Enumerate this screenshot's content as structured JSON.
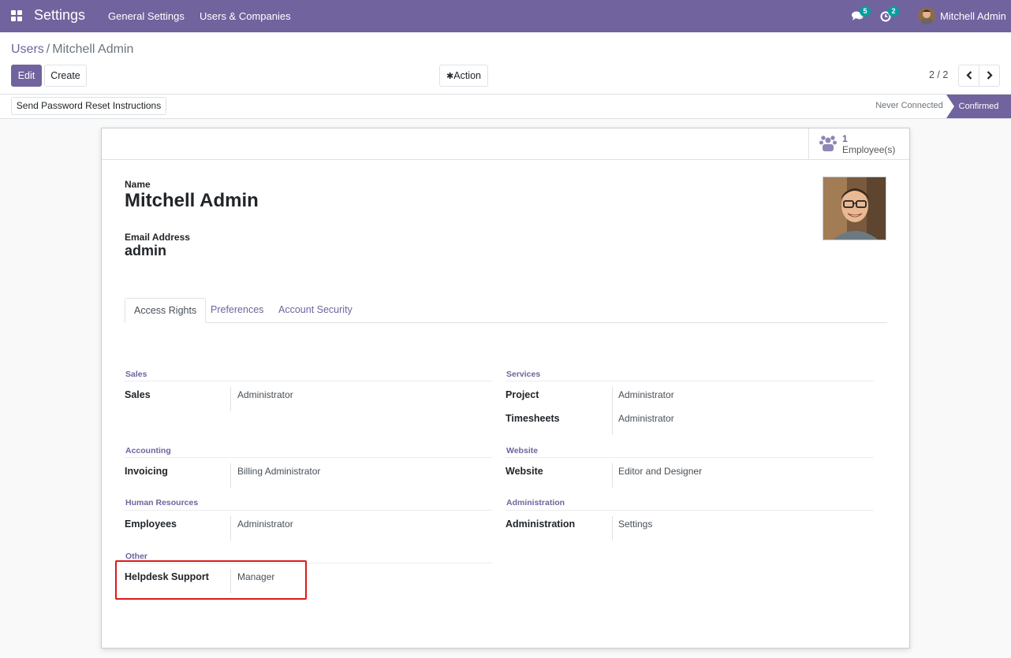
{
  "navbar": {
    "app_title": "Settings",
    "menu": [
      "General Settings",
      "Users & Companies"
    ],
    "messages_count": "5",
    "activities_count": "2",
    "user_name": "Mitchell Admin"
  },
  "breadcrumb": {
    "parent": "Users",
    "separator": "/",
    "current": "Mitchell Admin"
  },
  "toolbar": {
    "edit_label": "Edit",
    "create_label": "Create",
    "action_label": "Action",
    "pager": "2 / 2"
  },
  "statusbar": {
    "reset_button": "Send Password Reset Instructions",
    "stages": [
      "Never Connected",
      "Confirmed"
    ],
    "active_stage": "Confirmed"
  },
  "smart_button": {
    "value": "1",
    "label": "Employee(s)"
  },
  "form": {
    "name_label": "Name",
    "name_value": "Mitchell Admin",
    "email_label": "Email Address",
    "email_value": "admin"
  },
  "tabs": [
    "Access Rights",
    "Preferences",
    "Account Security"
  ],
  "active_tab": "Access Rights",
  "access_rights": {
    "left": [
      {
        "title": "Sales",
        "rows": [
          {
            "label": "Sales",
            "value": "Administrator"
          }
        ]
      },
      {
        "title": "Accounting",
        "rows": [
          {
            "label": "Invoicing",
            "value": "Billing Administrator"
          }
        ]
      },
      {
        "title": "Human Resources",
        "rows": [
          {
            "label": "Employees",
            "value": "Administrator"
          }
        ]
      },
      {
        "title": "Other",
        "rows": [
          {
            "label": "Helpdesk Support",
            "value": "Manager"
          }
        ]
      }
    ],
    "right": [
      {
        "title": "Services",
        "rows": [
          {
            "label": "Project",
            "value": "Administrator"
          },
          {
            "label": "Timesheets",
            "value": "Administrator"
          }
        ]
      },
      {
        "title": "Website",
        "rows": [
          {
            "label": "Website",
            "value": "Editor and Designer"
          }
        ]
      },
      {
        "title": "Administration",
        "rows": [
          {
            "label": "Administration",
            "value": "Settings"
          }
        ]
      }
    ]
  },
  "colors": {
    "brand": "#71639e",
    "highlight": "#dc1a1a",
    "badge": "#00a09d"
  }
}
